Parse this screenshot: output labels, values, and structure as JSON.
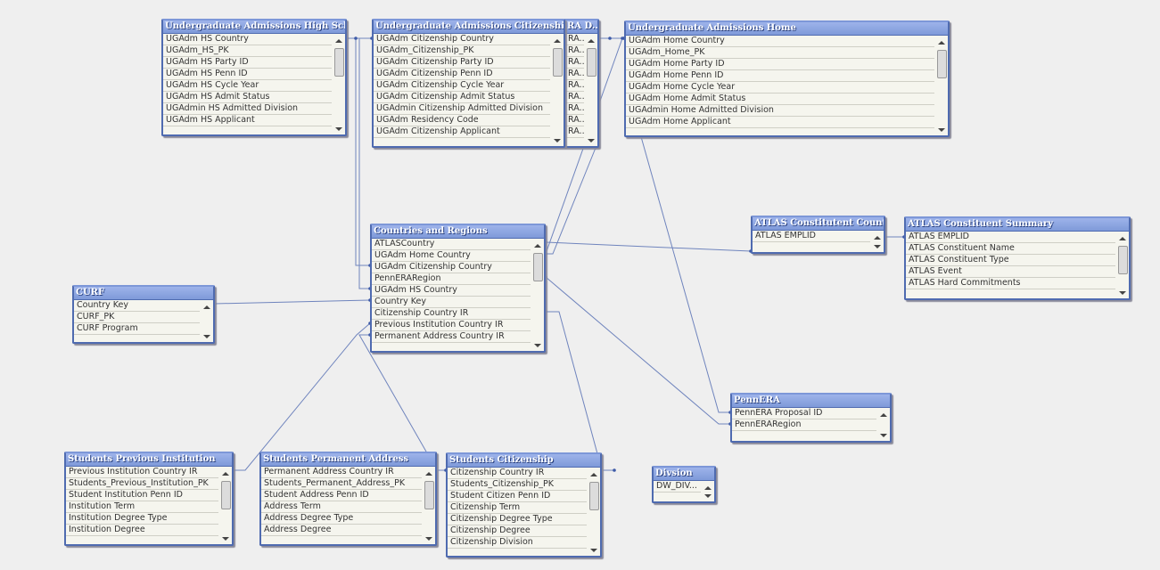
{
  "tables": [
    {
      "title": "Undergraduate Admissions High School",
      "fields": [
        "UGAdm HS Country",
        "UGAdm_HS_PK",
        "UGAdm HS Party ID",
        "UGAdm HS Penn ID",
        "UGAdm HS Cycle Year",
        "UGAdm HS Admit Status",
        "UGAdmin HS Admitted Division",
        "UGAdm HS Applicant"
      ]
    },
    {
      "title": "RA D...",
      "fields": [
        "RA...",
        "RA...",
        "RA...",
        "RA...",
        "RA...",
        "RA...",
        "RA...",
        "RA...",
        "RA..."
      ]
    },
    {
      "title": "Undergraduate Admissions Citizenship",
      "fields": [
        "UGAdm Citizenship Country",
        "UGAdm_Citizenship_PK",
        "UGAdm Citizenship Party ID",
        "UGAdm Citizenship Penn ID",
        "UGAdm Citizenship Cycle Year",
        "UGAdm Citizenship Admit Status",
        "UGAdmin Citizenship Admitted Division",
        "UGAdm Residency Code",
        "UGAdm Citizenship Applicant"
      ]
    },
    {
      "title": "Undergraduate Admissions Home",
      "fields": [
        "UGAdm Home Country",
        "UGAdm_Home_PK",
        "UGAdm Home Party ID",
        "UGAdm Home Penn ID",
        "UGAdm Home Cycle Year",
        "UGAdm Home Admit Status",
        "UGAdmin Home Admitted Division",
        "UGAdm Home Applicant"
      ]
    },
    {
      "title": "Countries and Regions",
      "fields": [
        "ATLASCountry",
        "UGAdm Home Country",
        "UGAdm Citizenship Country",
        "PennERARegion",
        "UGAdm HS Country",
        "Country Key",
        "Citizenship Country IR",
        "Previous Institution Country IR",
        "Permanent Address Country IR"
      ]
    },
    {
      "title": "CURF",
      "fields": [
        "Country Key",
        "CURF_PK",
        "CURF Program"
      ]
    },
    {
      "title": "ATLAS Constitutent Countries",
      "fields": [
        "ATLAS EMPLID"
      ]
    },
    {
      "title": "ATLAS Constituent Summary",
      "fields": [
        "ATLAS EMPLID",
        "ATLAS Constituent Name",
        "ATLAS Constituent Type",
        "ATLAS Event",
        "ATLAS Hard Commitments"
      ]
    },
    {
      "title": "PennERA",
      "fields": [
        "PennERA Proposal ID",
        "PennERARegion"
      ]
    },
    {
      "title": "Divsion",
      "fields": [
        "DW_DIV..."
      ]
    },
    {
      "title": "Students Previous Institution",
      "fields": [
        "Previous Institution Country IR",
        "Students_Previous_Institution_PK",
        "Student Institution Penn ID",
        "Institution Term",
        "Institution Degree Type",
        "Institution Degree"
      ]
    },
    {
      "title": "Students Permanent Address",
      "fields": [
        "Permanent Address Country IR",
        "Students_Permanent_Address_PK",
        "Student Address Penn ID",
        "Address Term",
        "Address Degree Type",
        "Address Degree"
      ]
    },
    {
      "title": "Students Citizenship",
      "fields": [
        "Citizenship Country IR",
        "Students_Citizenship_PK",
        "Student Citizen Penn ID",
        " Citizenship Term",
        "Citizenship Degree Type",
        "Citizenship Degree",
        "Citizenship Division"
      ]
    }
  ],
  "colors": {
    "header": "#7f9ad9",
    "border": "#4f6bb0",
    "link": "#6f84bd",
    "background": "#efefef"
  }
}
